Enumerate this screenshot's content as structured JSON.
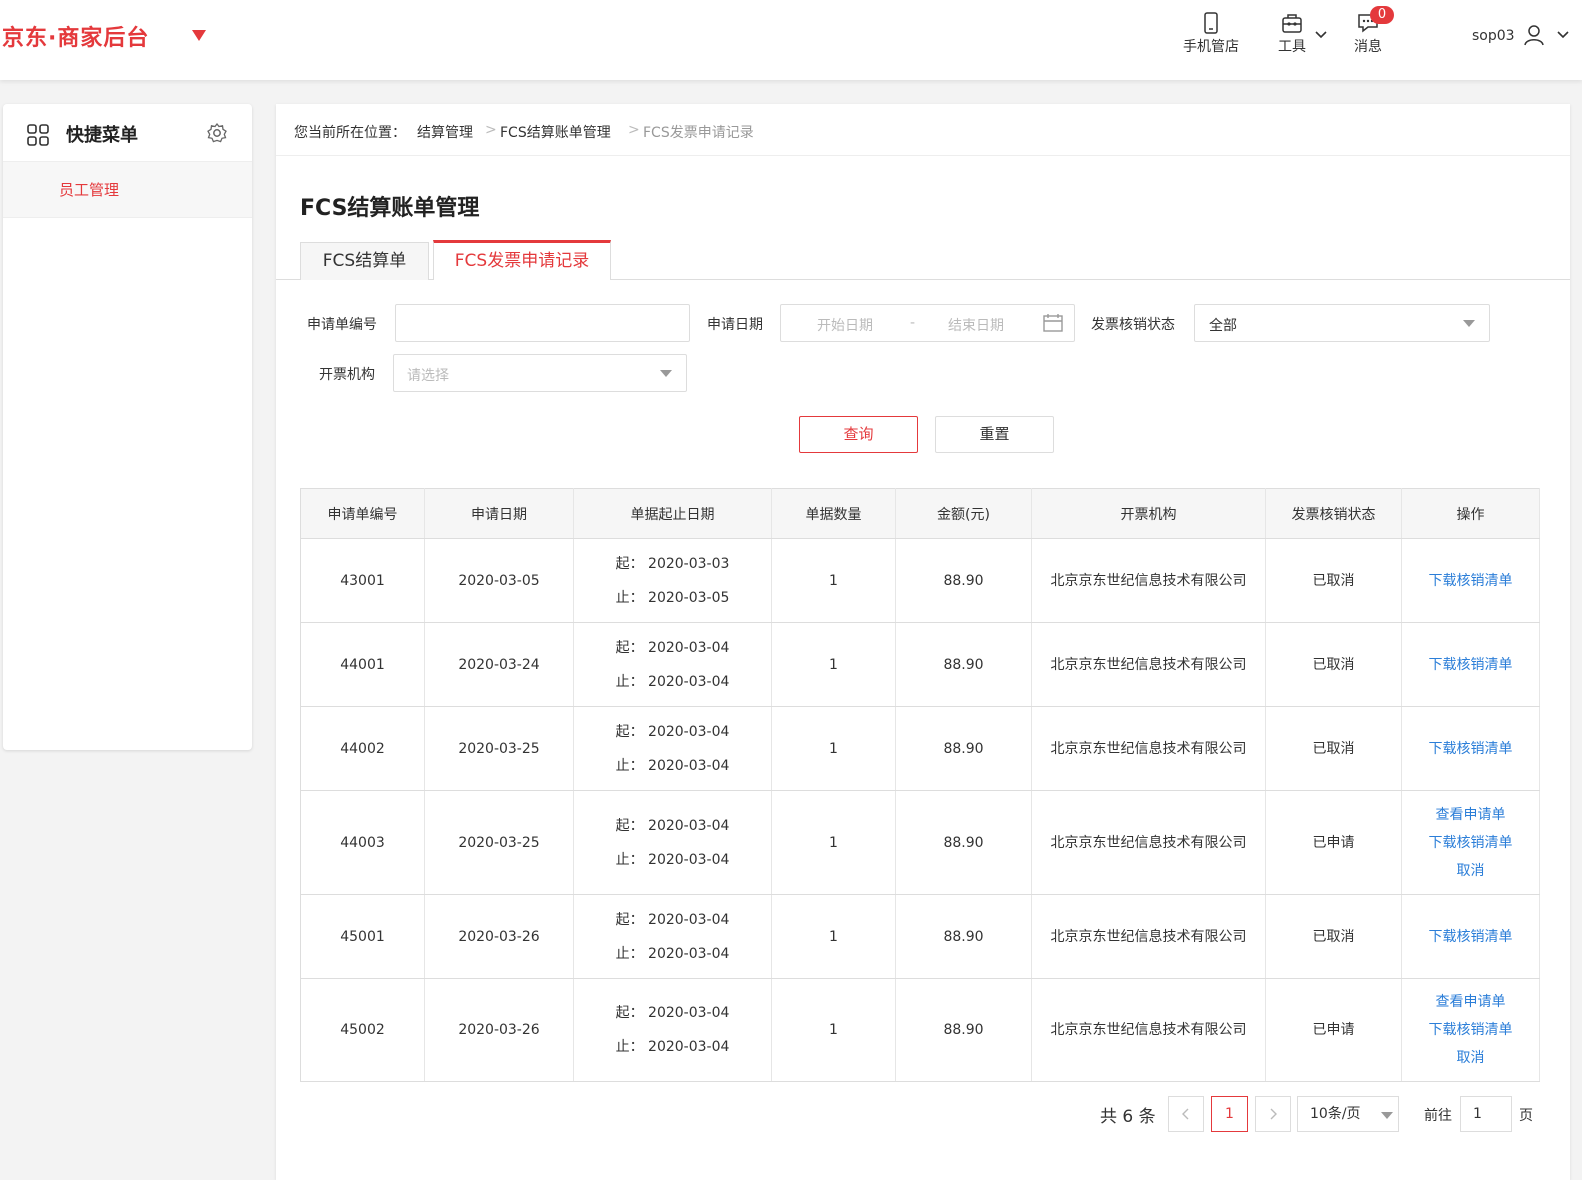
{
  "header": {
    "logo": "京东·商家后台",
    "mobile_label": "手机管店",
    "tools_label": "工具",
    "msg_label": "消息",
    "msg_count": "0",
    "username": "sop03"
  },
  "sidebar": {
    "title": "快捷菜单",
    "items": [
      {
        "label": "员工管理"
      }
    ]
  },
  "breadcrumb": {
    "prefix": "您当前所在位置：",
    "items": [
      "结算管理",
      "FCS结算账单管理",
      "FCS发票申请记录"
    ],
    "sep": ">"
  },
  "page_title": "FCS结算账单管理",
  "tabs": [
    "FCS结算单",
    "FCS发票申请记录"
  ],
  "filters": {
    "app_no_label": "申请单编号",
    "app_no_value": "",
    "date_label": "申请日期",
    "date_start_ph": "开始日期",
    "date_sep": "-",
    "date_end_ph": "结束日期",
    "status_label": "发票核销状态",
    "status_value": "全部",
    "org_label": "开票机构",
    "org_ph": "请选择"
  },
  "buttons": {
    "query": "查询",
    "reset": "重置"
  },
  "table": {
    "columns": [
      "申请单编号",
      "申请日期",
      "单据起止日期",
      "单据数量",
      "金额(元)",
      "开票机构",
      "发票核销状态",
      "操作"
    ],
    "start_prefix": "起：",
    "end_prefix": "止：",
    "rows": [
      {
        "id": "43001",
        "date": "2020-03-05",
        "start": "2020-03-03",
        "end": "2020-03-05",
        "qty": "1",
        "amount": "88.90",
        "org": "北京京东世纪信息技术有限公司",
        "status": "已取消",
        "actions": [
          "下载核销清单"
        ]
      },
      {
        "id": "44001",
        "date": "2020-03-24",
        "start": "2020-03-04",
        "end": "2020-03-04",
        "qty": "1",
        "amount": "88.90",
        "org": "北京京东世纪信息技术有限公司",
        "status": "已取消",
        "actions": [
          "下载核销清单"
        ]
      },
      {
        "id": "44002",
        "date": "2020-03-25",
        "start": "2020-03-04",
        "end": "2020-03-04",
        "qty": "1",
        "amount": "88.90",
        "org": "北京京东世纪信息技术有限公司",
        "status": "已取消",
        "actions": [
          "下载核销清单"
        ]
      },
      {
        "id": "44003",
        "date": "2020-03-25",
        "start": "2020-03-04",
        "end": "2020-03-04",
        "qty": "1",
        "amount": "88.90",
        "org": "北京京东世纪信息技术有限公司",
        "status": "已申请",
        "actions": [
          "查看申请单",
          "下载核销清单",
          "取消"
        ]
      },
      {
        "id": "45001",
        "date": "2020-03-26",
        "start": "2020-03-04",
        "end": "2020-03-04",
        "qty": "1",
        "amount": "88.90",
        "org": "北京京东世纪信息技术有限公司",
        "status": "已取消",
        "actions": [
          "下载核销清单"
        ]
      },
      {
        "id": "45002",
        "date": "2020-03-26",
        "start": "2020-03-04",
        "end": "2020-03-04",
        "qty": "1",
        "amount": "88.90",
        "org": "北京京东世纪信息技术有限公司",
        "status": "已申请",
        "actions": [
          "查看申请单",
          "下载核销清单",
          "取消"
        ]
      }
    ]
  },
  "pagination": {
    "total_text": "共 6 条",
    "current": "1",
    "page_size": "10条/页",
    "goto_label": "前往",
    "goto_value": "1",
    "page_suffix": "页"
  }
}
